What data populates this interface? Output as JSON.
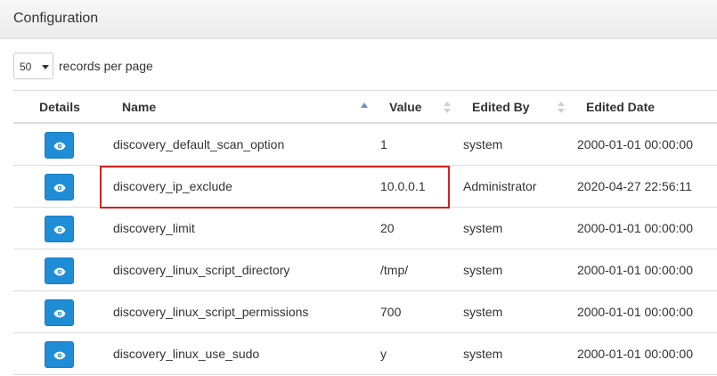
{
  "panel": {
    "title": "Configuration"
  },
  "length": {
    "value": "50",
    "label": "records per page"
  },
  "columns": {
    "details": "Details",
    "name": "Name",
    "value": "Value",
    "edited_by": "Edited By",
    "edited_date": "Edited Date"
  },
  "rows": [
    {
      "name": "discovery_default_scan_option",
      "value": "1",
      "edited_by": "system",
      "edited_date": "2000-01-01 00:00:00"
    },
    {
      "name": "discovery_ip_exclude",
      "value": "10.0.0.1",
      "edited_by": "Administrator",
      "edited_date": "2020-04-27 22:56:11"
    },
    {
      "name": "discovery_limit",
      "value": "20",
      "edited_by": "system",
      "edited_date": "2000-01-01 00:00:00"
    },
    {
      "name": "discovery_linux_script_directory",
      "value": "/tmp/",
      "edited_by": "system",
      "edited_date": "2000-01-01 00:00:00"
    },
    {
      "name": "discovery_linux_script_permissions",
      "value": "700",
      "edited_by": "system",
      "edited_date": "2000-01-01 00:00:00"
    },
    {
      "name": "discovery_linux_use_sudo",
      "value": "y",
      "edited_by": "system",
      "edited_date": "2000-01-01 00:00:00"
    }
  ],
  "icons": {
    "details": "eye-icon",
    "sort_asc": "sort-asc-icon",
    "sort_both": "sort-both-icon"
  },
  "colors": {
    "button": "#1f8dd6",
    "highlight": "#d42020",
    "sort_active": "#6f8ec9"
  }
}
